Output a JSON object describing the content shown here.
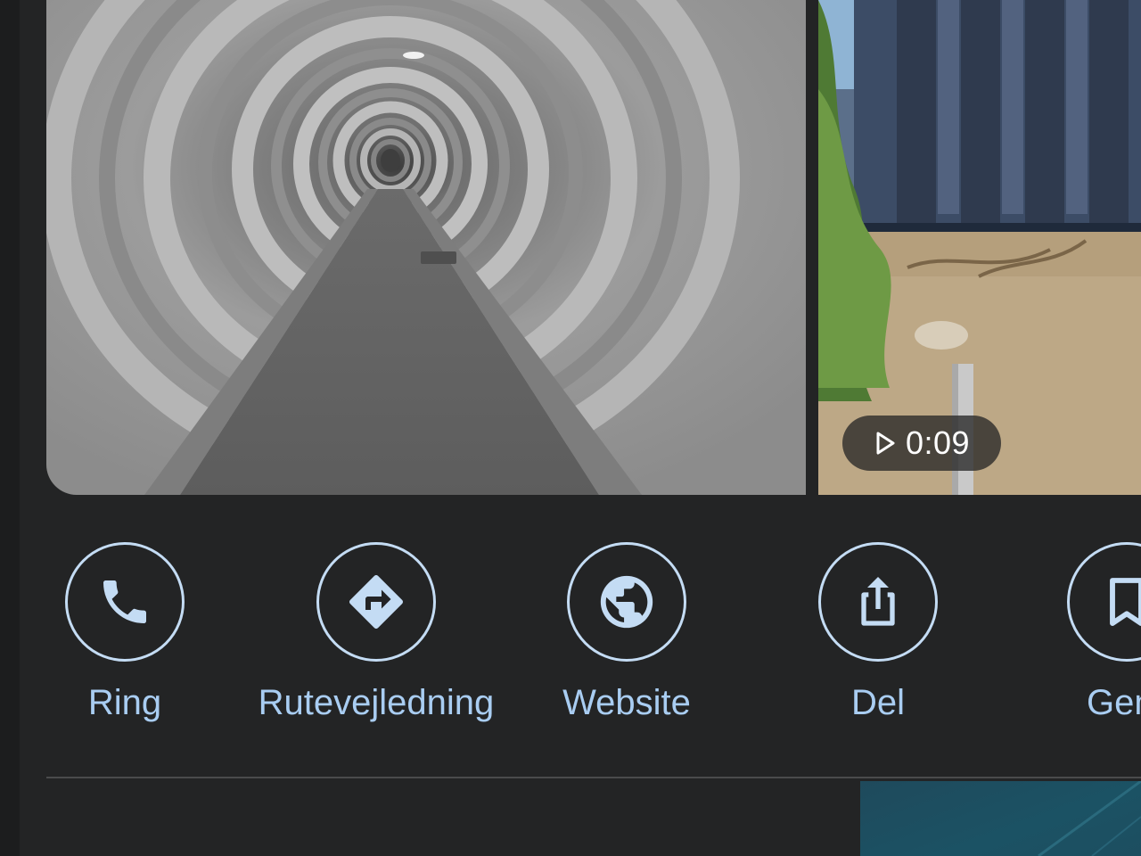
{
  "photos": {
    "main_photo": {
      "subject": "tunnel"
    },
    "video_photo": {
      "duration": "0:09",
      "play_icon": "play-icon"
    }
  },
  "actions": [
    {
      "id": "call",
      "label": "Ring",
      "icon": "phone-icon"
    },
    {
      "id": "directions",
      "label": "Rutevejledning",
      "icon": "directions-icon"
    },
    {
      "id": "website",
      "label": "Website",
      "icon": "globe-icon"
    },
    {
      "id": "share",
      "label": "Del",
      "icon": "share-icon"
    },
    {
      "id": "save",
      "label": "Gem",
      "icon": "bookmark-icon"
    }
  ],
  "colors": {
    "background": "#232425",
    "accent": "#a9cdf2",
    "icon_stroke": "#c4dcf4"
  }
}
